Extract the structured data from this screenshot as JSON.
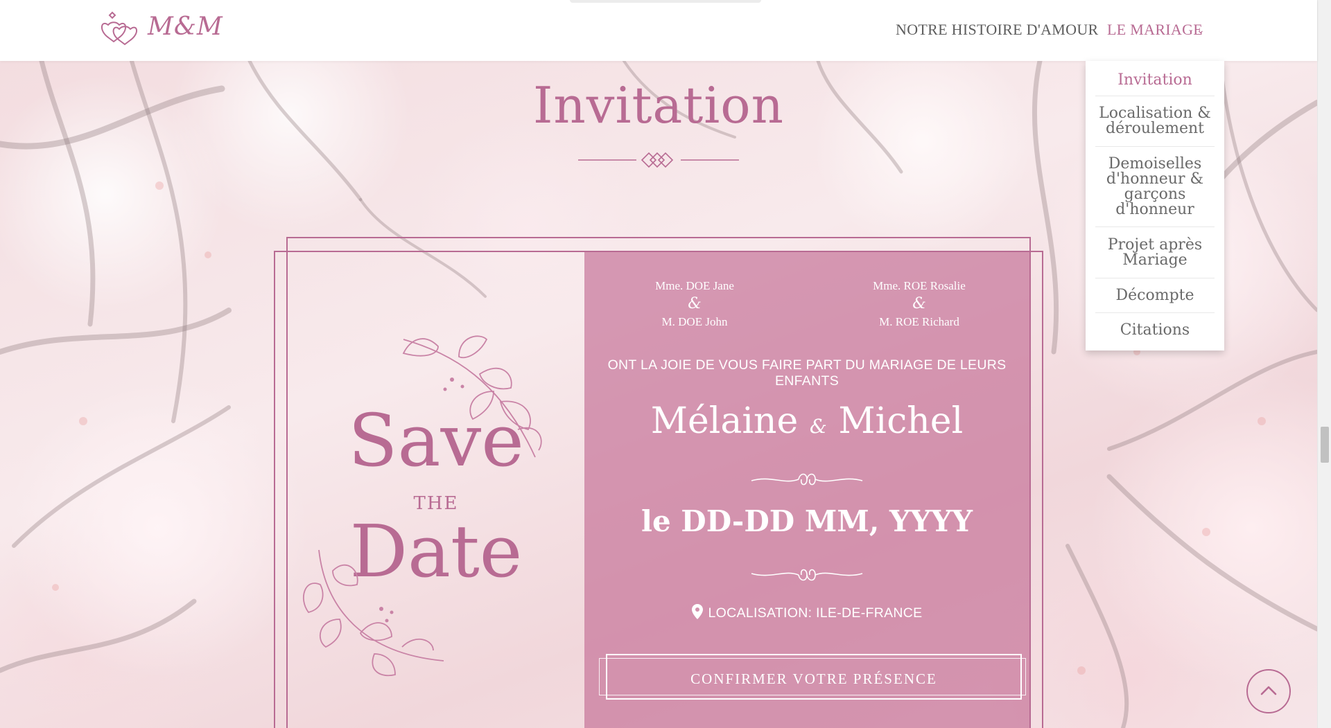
{
  "header": {
    "logo_text": "M&M",
    "nav": {
      "histoire": "NOTRE HISTOIRE D'AMOUR",
      "mariage": "LE MARIAGE"
    }
  },
  "dropdown": {
    "items": [
      {
        "label": "Invitation",
        "active": true
      },
      {
        "label": "Localisation & déroulement"
      },
      {
        "label": "Demoiselles d'honneur & garçons d'honneur"
      },
      {
        "label": "Projet après Mariage"
      },
      {
        "label": "Décompte"
      },
      {
        "label": "Citations"
      }
    ]
  },
  "section": {
    "title": "Invitation"
  },
  "card": {
    "save": "Save",
    "the": "THE",
    "date": "Date",
    "parents_left": {
      "line1": "Mme. DOE Jane",
      "amp": "&",
      "line2": "M. DOE John"
    },
    "parents_right": {
      "line1": "Mme. ROE Rosalie",
      "amp": "&",
      "line2": "M. ROE Richard"
    },
    "announcement": "ONT LA JOIE DE VOUS FAIRE PART DU MARIAGE DE LEURS ENFANTS",
    "bride": "Mélaine",
    "couple_amp": "&",
    "groom": "Michel",
    "wedding_date": "le DD-DD MM, YYYY",
    "location": "LOCALISATION: ILE-DE-FRANCE",
    "rsvp_label": "CONFIRMER VOTRE PRÉSENCE"
  },
  "colors": {
    "accent": "#b86b93",
    "card_panel": "#c47096",
    "text_muted": "#5d5d5d"
  },
  "icons": [
    "rings-hearts-logo-icon",
    "chevron-down-icon",
    "map-pin-icon",
    "arrow-up-icon",
    "diamond-ornament-icon",
    "flourish-icon",
    "leaf-branch-icon"
  ]
}
